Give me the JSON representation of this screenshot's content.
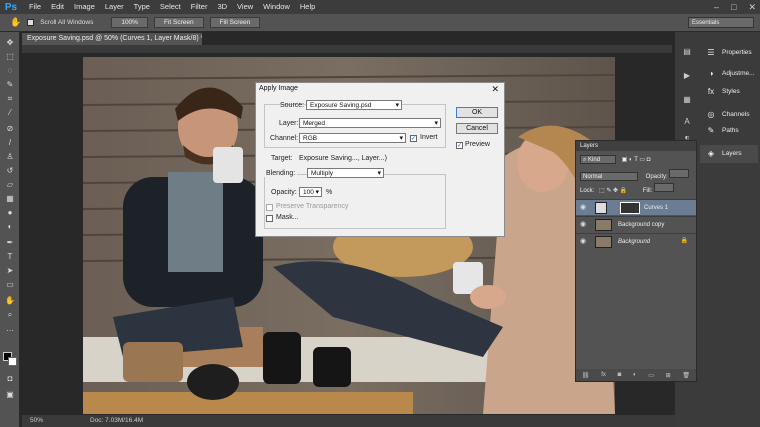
{
  "app": {
    "logo": "Ps",
    "menu": [
      "File",
      "Edit",
      "Image",
      "Layer",
      "Type",
      "Select",
      "Filter",
      "3D",
      "View",
      "Window",
      "Help"
    ],
    "window_controls": [
      "–",
      "□",
      "✕"
    ]
  },
  "options_bar": {
    "scroll_all": "Scroll All Windows",
    "btn_100": "100%",
    "btn_fit": "Fit Screen",
    "btn_fill": "Fill Screen",
    "workspace": "Essentials"
  },
  "document": {
    "tab_title": "Exposure Saving.psd @ 50% (Curves 1, Layer Mask/8) *",
    "zoom": "50%",
    "doc_size": "Doc: 7.03M/16.4M"
  },
  "panels_dock": [
    "Properties",
    "Adjustme...",
    "Styles",
    "Channels",
    "Paths",
    "Layers"
  ],
  "layers": {
    "tab": "Layers",
    "kind": "Kind",
    "blend": "Normal",
    "opacity_label": "Opacity:",
    "lock_label": "Lock:",
    "fill_label": "Fill:",
    "items": [
      {
        "name": "Curves 1",
        "selected": true
      },
      {
        "name": "Background copy",
        "selected": false
      },
      {
        "name": "Background",
        "selected": false
      }
    ]
  },
  "apply_image": {
    "title": "Apply Image",
    "source_label": "Source:",
    "source_value": "Exposure Saving.psd",
    "layer_label": "Layer:",
    "layer_value": "Merged",
    "channel_label": "Channel:",
    "channel_value": "RGB",
    "invert_label": "Invert",
    "target_label": "Target:",
    "target_value": "Exposure Saving..., Layer...)",
    "blending_label": "Blending:",
    "blending_value": "Multiply",
    "opacity_label": "Opacity:",
    "opacity_value": "100",
    "opacity_unit": "%",
    "preserve_label": "Preserve Transparency",
    "mask_label": "Mask...",
    "ok": "OK",
    "cancel": "Cancel",
    "preview_label": "Preview"
  }
}
